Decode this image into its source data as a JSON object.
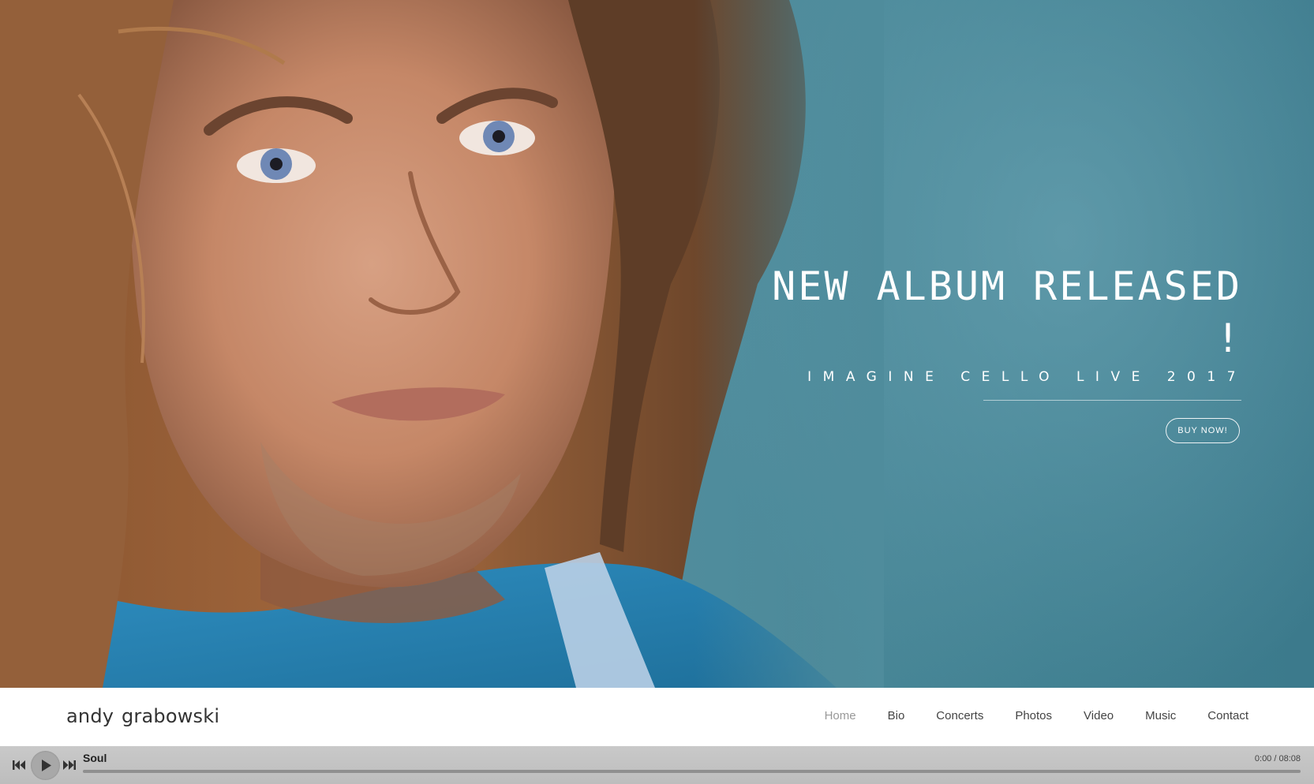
{
  "hero": {
    "title_line1": "NEW ALBUM RELEASED",
    "title_line2": "!",
    "subtitle": "IMAGINE CELLO LIVE 2017",
    "button_label": "BUY NOW!"
  },
  "header": {
    "logo": "andy grabowski",
    "nav": [
      {
        "label": "Home",
        "active": true
      },
      {
        "label": "Bio"
      },
      {
        "label": "Concerts"
      },
      {
        "label": "Photos"
      },
      {
        "label": "Video"
      },
      {
        "label": "Music"
      },
      {
        "label": "Contact"
      }
    ]
  },
  "player": {
    "track_title": "Soul",
    "time": "0:00 / 08:08",
    "progress": 0
  },
  "colors": {
    "hero_background": "#4f8c9c",
    "player_background": "#c4c4c4",
    "nav_active": "#999999"
  }
}
